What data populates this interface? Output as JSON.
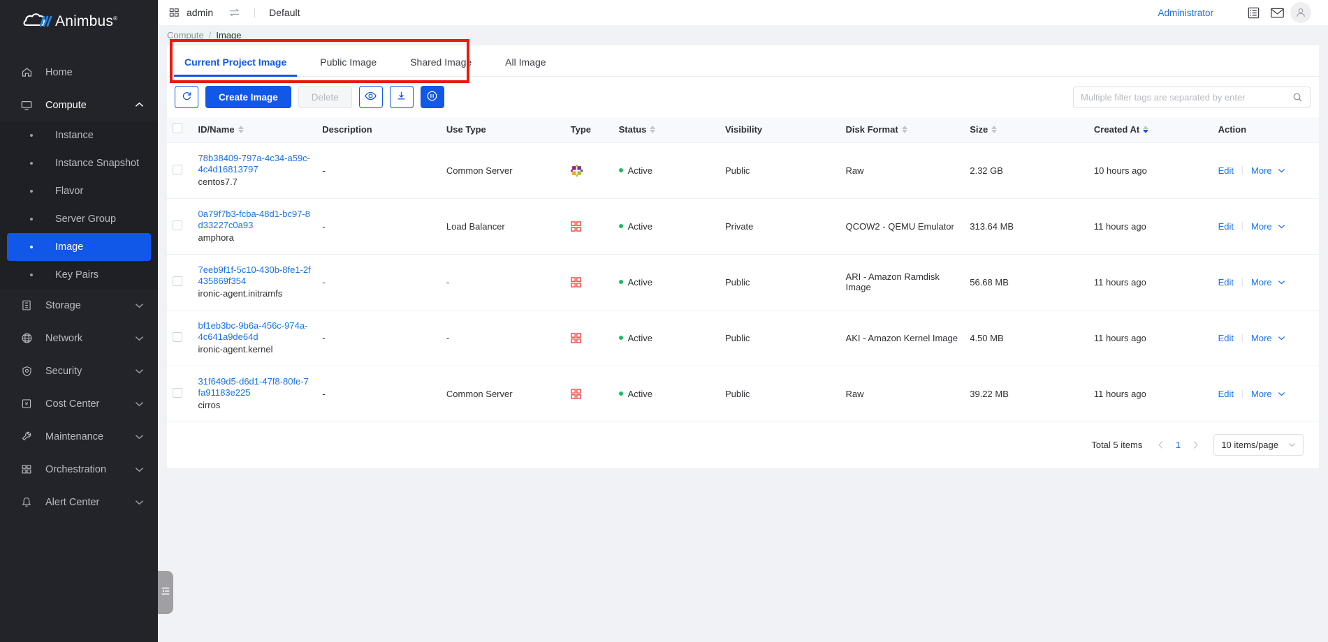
{
  "brand": {
    "name": "Animbus",
    "registered": "®"
  },
  "sidebar": {
    "items": [
      {
        "label": "Home",
        "icon": "home-icon",
        "expandable": false
      },
      {
        "label": "Compute",
        "icon": "monitor-icon",
        "expandable": true,
        "expanded": true
      },
      {
        "label": "Storage",
        "icon": "storage-icon",
        "expandable": true,
        "expanded": false
      },
      {
        "label": "Network",
        "icon": "globe-icon",
        "expandable": true,
        "expanded": false
      },
      {
        "label": "Security",
        "icon": "shield-icon",
        "expandable": true,
        "expanded": false
      },
      {
        "label": "Cost Center",
        "icon": "cost-icon",
        "expandable": true,
        "expanded": false
      },
      {
        "label": "Maintenance",
        "icon": "wrench-icon",
        "expandable": true,
        "expanded": false
      },
      {
        "label": "Orchestration",
        "icon": "grid-icon",
        "expandable": true,
        "expanded": false
      },
      {
        "label": "Alert Center",
        "icon": "bell-icon",
        "expandable": true,
        "expanded": false
      }
    ],
    "compute_children": [
      {
        "label": "Instance",
        "active": false
      },
      {
        "label": "Instance Snapshot",
        "active": false
      },
      {
        "label": "Flavor",
        "active": false
      },
      {
        "label": "Server Group",
        "active": false
      },
      {
        "label": "Image",
        "active": true
      },
      {
        "label": "Key Pairs",
        "active": false
      }
    ],
    "collapse_icon": "collapse-panel-icon"
  },
  "topbar": {
    "project_icon": "grid-icon",
    "project": "admin",
    "switch_icon": "switch-icon",
    "domain": "Default",
    "user_role": "Administrator",
    "list_icon": "list-icon",
    "mail_icon": "mail-icon",
    "avatar_icon": "user-avatar-icon"
  },
  "breadcrumb": {
    "parent": "Compute",
    "separator": "/",
    "current": "Image"
  },
  "tabs": [
    {
      "label": "Current Project Image",
      "active": true
    },
    {
      "label": "Public Image",
      "active": false
    },
    {
      "label": "Shared Image",
      "active": false
    },
    {
      "label": "All Image",
      "active": false
    }
  ],
  "highlight_color": "#e81a10",
  "accent_color": "#1157e8",
  "toolbar": {
    "refresh_icon": "refresh-icon",
    "create_label": "Create Image",
    "delete_label": "Delete",
    "view_icon": "eye-icon",
    "download_icon": "download-icon",
    "pause_icon": "pause-circle-icon"
  },
  "search": {
    "placeholder": "Multiple filter tags are separated by enter",
    "value": "",
    "icon": "search-icon"
  },
  "table": {
    "columns": [
      {
        "key": "checkbox",
        "label": "",
        "sortable": false
      },
      {
        "key": "id_name",
        "label": "ID/Name",
        "sortable": true
      },
      {
        "key": "description",
        "label": "Description",
        "sortable": false
      },
      {
        "key": "use_type",
        "label": "Use Type",
        "sortable": false
      },
      {
        "key": "type",
        "label": "Type",
        "sortable": false
      },
      {
        "key": "status",
        "label": "Status",
        "sortable": true
      },
      {
        "key": "visibility",
        "label": "Visibility",
        "sortable": false
      },
      {
        "key": "disk_format",
        "label": "Disk Format",
        "sortable": true
      },
      {
        "key": "size",
        "label": "Size",
        "sortable": true
      },
      {
        "key": "created_at",
        "label": "Created At",
        "sortable": true,
        "sort": "desc"
      },
      {
        "key": "action",
        "label": "Action",
        "sortable": false
      }
    ],
    "rows": [
      {
        "id": "78b38409-797a-4c34-a59c-4c4d16813797",
        "name": "centos7.7",
        "description": "-",
        "use_type": "Common Server",
        "type_icon": "centos-logo-icon",
        "status": "Active",
        "visibility": "Public",
        "disk_format": "Raw",
        "size": "2.32 GB",
        "created_at": "10 hours ago",
        "edit_label": "Edit",
        "more_label": "More"
      },
      {
        "id": "0a79f7b3-fcba-48d1-bc97-8d33227c0a93",
        "name": "amphora",
        "description": "-",
        "use_type": "Load Balancer",
        "type_icon": "generic-image-icon",
        "status": "Active",
        "visibility": "Private",
        "disk_format": "QCOW2 - QEMU Emulator",
        "size": "313.64 MB",
        "created_at": "11 hours ago",
        "edit_label": "Edit",
        "more_label": "More"
      },
      {
        "id": "7eeb9f1f-5c10-430b-8fe1-2f435869f354",
        "name": "ironic-agent.initramfs",
        "description": "-",
        "use_type": "-",
        "type_icon": "generic-image-icon",
        "status": "Active",
        "visibility": "Public",
        "disk_format": "ARI - Amazon Ramdisk Image",
        "size": "56.68 MB",
        "created_at": "11 hours ago",
        "edit_label": "Edit",
        "more_label": "More"
      },
      {
        "id": "bf1eb3bc-9b6a-456c-974a-4c641a9de64d",
        "name": "ironic-agent.kernel",
        "description": "-",
        "use_type": "-",
        "type_icon": "generic-image-icon",
        "status": "Active",
        "visibility": "Public",
        "disk_format": "AKI - Amazon Kernel Image",
        "size": "4.50 MB",
        "created_at": "11 hours ago",
        "edit_label": "Edit",
        "more_label": "More"
      },
      {
        "id": "31f649d5-d6d1-47f8-80fe-7fa91183e225",
        "name": "cirros",
        "description": "-",
        "use_type": "Common Server",
        "type_icon": "generic-image-icon",
        "status": "Active",
        "visibility": "Public",
        "disk_format": "Raw",
        "size": "39.22 MB",
        "created_at": "11 hours ago",
        "edit_label": "Edit",
        "more_label": "More"
      }
    ]
  },
  "pagination": {
    "total_label": "Total 5 items",
    "prev_icon": "chevron-left-icon",
    "current_page": "1",
    "next_icon": "chevron-right-icon",
    "page_size_label": "10 items/page"
  }
}
